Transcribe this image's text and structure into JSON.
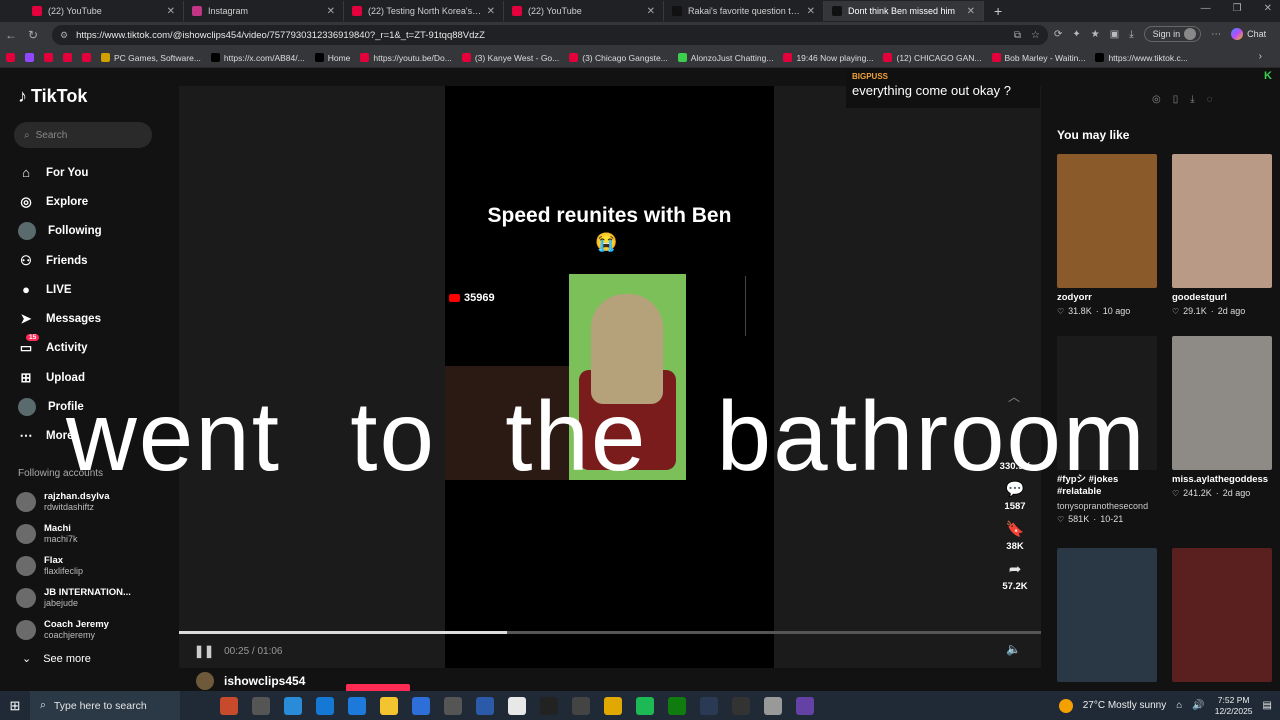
{
  "browser": {
    "tabs": [
      {
        "title": "(22) YouTube",
        "color": "#e4003a"
      },
      {
        "title": "Instagram",
        "color": "#c13584"
      },
      {
        "title": "(22) Testing North Korea's illegal",
        "color": "#e4003a"
      },
      {
        "title": "(22) YouTube",
        "color": "#e4003a"
      },
      {
        "title": "Rakai's favorite question to ask",
        "color": "#111111"
      },
      {
        "title": "Dont think Ben missed him",
        "color": "#111111"
      }
    ],
    "url": "https://www.tiktok.com/@ishowclips454/video/7577930312336919840?_r=1&_t=ZT-91tqq88VdzZ",
    "signin_label": "Sign in",
    "chat_label": "Chat",
    "bookmarks": [
      {
        "label": "",
        "color": "#e4003a"
      },
      {
        "label": "",
        "color": "#9146ff"
      },
      {
        "label": "",
        "color": "#e4003a"
      },
      {
        "label": "",
        "color": "#e4003a"
      },
      {
        "label": "",
        "color": "#e4003a"
      },
      {
        "label": "PC Games, Software...",
        "color": "#d0a000"
      },
      {
        "label": "https://x.com/AB84/...",
        "color": "#000000"
      },
      {
        "label": "Home",
        "color": "#000000"
      },
      {
        "label": "https://youtu.be/Do...",
        "color": "#e4003a"
      },
      {
        "label": "(3) Kanye West - Go...",
        "color": "#e4003a"
      },
      {
        "label": "(3) Chicago Gangste...",
        "color": "#e4003a"
      },
      {
        "label": "AlonzoJust Chatting...",
        "color": "#3ccf4e"
      },
      {
        "label": "19:46 Now playing...",
        "color": "#e4003a"
      },
      {
        "label": "(12) CHICAGO GAN...",
        "color": "#e4003a"
      },
      {
        "label": "Bob Marley - Waitin...",
        "color": "#e4003a"
      },
      {
        "label": "https://www.tiktok.c...",
        "color": "#000000"
      }
    ]
  },
  "tiktok": {
    "logo": "TikTok",
    "search_placeholder": "Search",
    "nav": [
      {
        "label": "For You",
        "icon": "home-icon"
      },
      {
        "label": "Explore",
        "icon": "compass-icon"
      },
      {
        "label": "Following",
        "icon": "avatar"
      },
      {
        "label": "Friends",
        "icon": "friends-icon"
      },
      {
        "label": "LIVE",
        "icon": "live-icon"
      },
      {
        "label": "Messages",
        "icon": "send-icon"
      },
      {
        "label": "Activity",
        "icon": "inbox-icon",
        "badge": "15"
      },
      {
        "label": "Upload",
        "icon": "plus-icon"
      },
      {
        "label": "Profile",
        "icon": "avatar"
      },
      {
        "label": "More",
        "icon": "more-icon"
      }
    ],
    "following_title": "Following accounts",
    "following": [
      {
        "name": "rajzhan.dsylva",
        "handle": "rdwitdashiftz"
      },
      {
        "name": "Machi",
        "handle": "machi7k"
      },
      {
        "name": "Flax",
        "handle": "flaxlifeclip"
      },
      {
        "name": "JB INTERNATION...",
        "handle": "jabejude"
      },
      {
        "name": "Coach Jeremy",
        "handle": "coachjeremy"
      }
    ],
    "see_more": "See more",
    "video": {
      "title": "Speed  reunites with Ben",
      "emoji": "😭",
      "yt_count": "35969",
      "caption_overlay": "went  to the bathroom",
      "time": "00:25 / 01:06",
      "progress": 0.38,
      "author": "ishowclips454"
    },
    "actions": [
      {
        "icon": "heart-icon",
        "count": "330.9K"
      },
      {
        "icon": "comment-icon",
        "count": "1587"
      },
      {
        "icon": "bookmark-icon",
        "count": "38K"
      },
      {
        "icon": "share-icon",
        "count": "57.2K"
      }
    ],
    "live_comment": {
      "user": "BIGPUSS",
      "text": "everything come out okay ?"
    },
    "you_may_like": "You may like",
    "suggestions": [
      {
        "caption": "zodyorr",
        "likes": "31.8K",
        "age": "10 ago",
        "color": "#8a5a2a"
      },
      {
        "caption": "goodestgurl",
        "likes": "29.1K",
        "age": "2d ago",
        "color": "#b89a86"
      },
      {
        "caption": "#fypシ #jokes #relatable",
        "sub": "tonysopranothesecond",
        "likes": "581K",
        "age": "10-21",
        "color": "#1b1b1b"
      },
      {
        "caption": "miss.aylathegoddess",
        "likes": "241.2K",
        "age": "2d ago",
        "color": "#8e8a86"
      },
      {
        "caption": "",
        "likes": "",
        "age": "",
        "color": "#2a3744"
      },
      {
        "caption": "",
        "likes": "",
        "age": "",
        "color": "#5a1f1f"
      }
    ]
  },
  "taskbar": {
    "search_placeholder": "Type here to search",
    "weather": "27°C  Mostly sunny",
    "time": "7:52 PM",
    "date": "12/2/2025"
  }
}
